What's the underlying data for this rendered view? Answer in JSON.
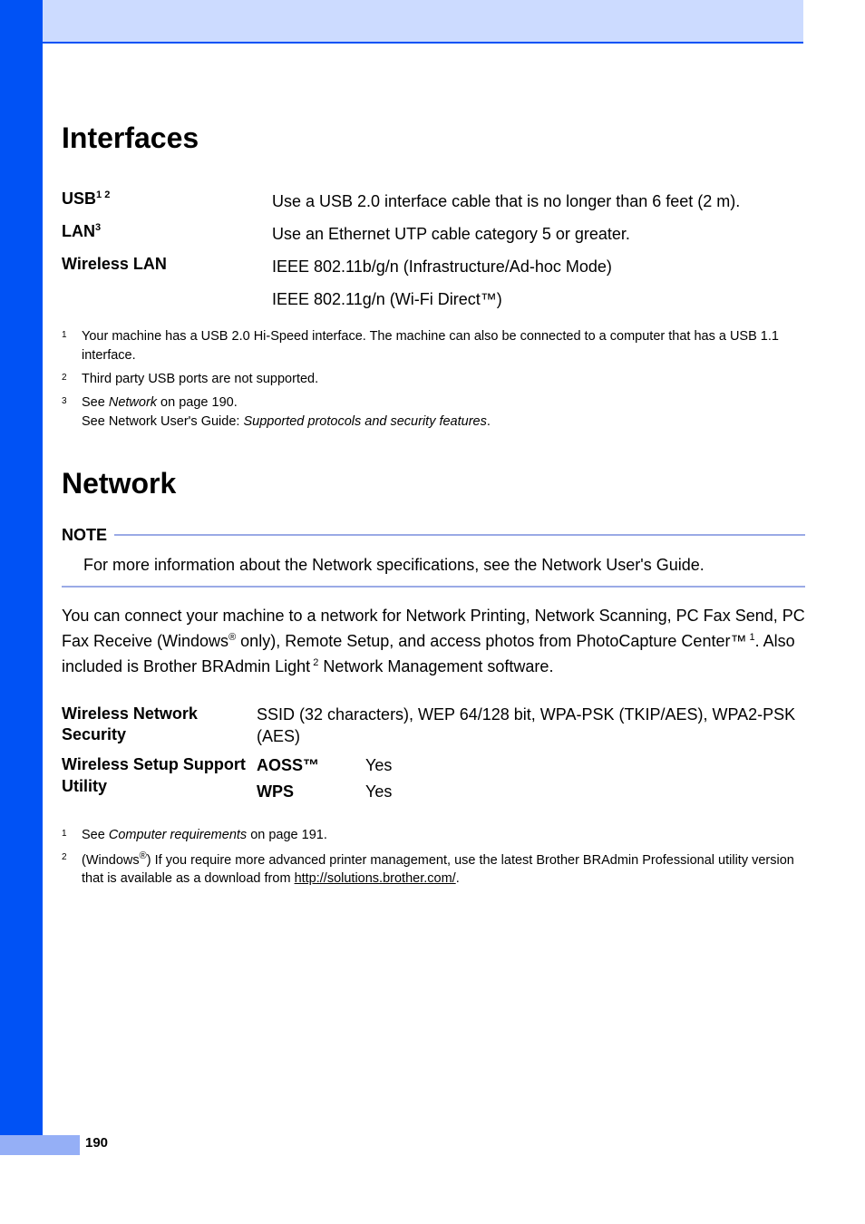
{
  "section1_title": "Interfaces",
  "interfaces": {
    "usb_label": "USB",
    "usb_sup": "1 2",
    "usb_value": "Use a USB 2.0 interface cable that is no longer than 6 feet (2 m).",
    "lan_label": "LAN",
    "lan_sup": "3",
    "lan_value": "Use an Ethernet UTP cable category 5 or greater.",
    "wlan_label": "Wireless LAN",
    "wlan_value_1": "IEEE 802.11b/g/n (Infrastructure/Ad-hoc Mode)",
    "wlan_value_2": "IEEE 802.11g/n (Wi-Fi Direct™)"
  },
  "interfaces_fn": {
    "f1": "Your machine has a USB 2.0 Hi-Speed interface. The machine can also be connected to a computer that has a USB 1.1 interface.",
    "f2": "Third party USB ports are not supported.",
    "f3_pre": "See ",
    "f3_link": "Network",
    "f3_post": " on page 190.",
    "f3_line2_pre": "See Network User's Guide: ",
    "f3_line2_ital": "Supported protocols and security features",
    "f3_line2_post": "."
  },
  "section2_title": "Network",
  "note_label": "NOTE",
  "note_body": "For more information about the Network specifications, see the Network User's Guide.",
  "network_intro": {
    "part1": "You can connect your machine to a network for Network Printing, Network Scanning, PC Fax Send, PC Fax Receive (Windows",
    "sup1": "®",
    "part2": " only), Remote Setup, and access photos from PhotoCapture Center™",
    "sup2": "1",
    "part3": ". Also included is Brother BRAdmin Light",
    "sup3": "2",
    "part4": " Network Management software."
  },
  "network_table": {
    "security_label": "Wireless Network Security",
    "security_value": "SSID (32 characters), WEP 64/128 bit, WPA-PSK (TKIP/AES), WPA2-PSK (AES)",
    "setup_label": "Wireless Setup Support Utility",
    "aoss_label": "AOSS™",
    "aoss_value": "Yes",
    "wps_label": "WPS",
    "wps_value": "Yes"
  },
  "network_fn": {
    "f1_pre": "See ",
    "f1_link": "Computer requirements",
    "f1_post": " on page 191.",
    "f2_pre": "(Windows",
    "f2_sup": "®",
    "f2_mid": ") If you require more advanced printer management, use the latest Brother BRAdmin Professional utility version that is available as a download from ",
    "f2_link": "http://solutions.brother.com/",
    "f2_post": "."
  },
  "page_number": "190"
}
